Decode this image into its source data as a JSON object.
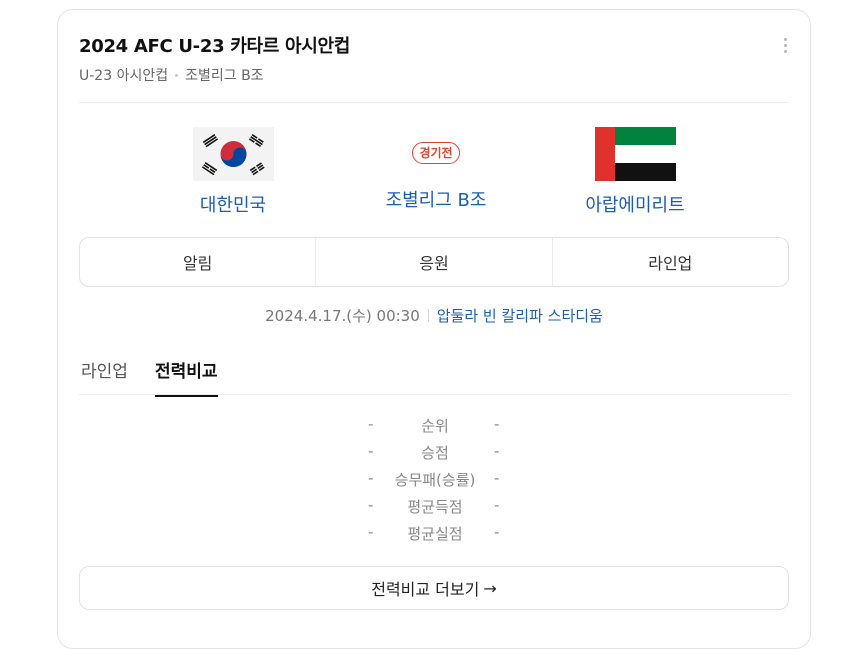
{
  "header": {
    "title": "2024 AFC U-23 카타르 아시안컵",
    "competition": "U-23 아시안컵",
    "group": "조별리그 B조"
  },
  "match": {
    "home": {
      "name": "대한민국"
    },
    "away": {
      "name": "아랍에미리트"
    },
    "status": "경기전",
    "stage": "조별리그 B조",
    "datetime": "2024.4.17.(수) 00:30",
    "venue": "압둘라 빈 칼리파 스타디움"
  },
  "actions": [
    "알림",
    "응원",
    "라인업"
  ],
  "tabs": {
    "lineup": "라인업",
    "compare": "전력비교"
  },
  "stats": [
    {
      "label": "순위",
      "home": "-",
      "away": "-"
    },
    {
      "label": "승점",
      "home": "-",
      "away": "-"
    },
    {
      "label": "승무패(승률)",
      "home": "-",
      "away": "-"
    },
    {
      "label": "평균득점",
      "home": "-",
      "away": "-"
    },
    {
      "label": "평균실점",
      "home": "-",
      "away": "-"
    }
  ],
  "more_button": {
    "label": "전력비교 더보기",
    "arrow": "→"
  },
  "colors": {
    "link": "#1a5fb4",
    "badge": "#e0452f"
  }
}
